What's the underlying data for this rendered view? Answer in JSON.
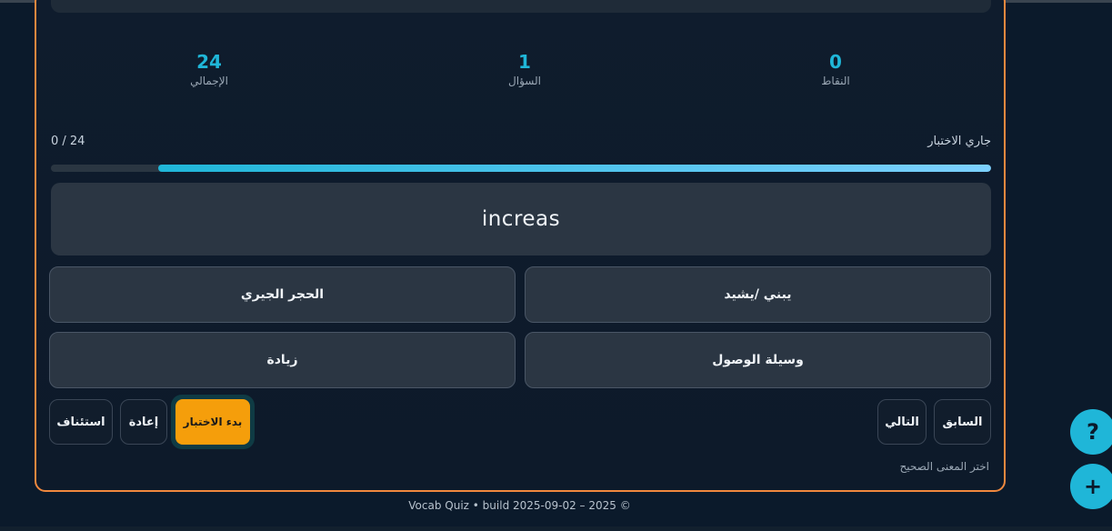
{
  "stats": {
    "total_value": "24",
    "total_label": "الإجمالي",
    "question_value": "1",
    "question_label": "السؤال",
    "points_value": "0",
    "points_label": "النقاط"
  },
  "status": {
    "count_text": "0 / 24",
    "state_text": "جاري الاختبار",
    "progress_fraction": 0.886
  },
  "question": {
    "word": "increas"
  },
  "options": [
    {
      "label": "يبني /يشيد"
    },
    {
      "label": "الحجر الجيري"
    },
    {
      "label": "وسيلة الوصول"
    },
    {
      "label": "زيادة"
    }
  ],
  "controls": {
    "previous_label": "السابق",
    "next_label": "التالي",
    "start_label": "بدء الاختبار",
    "reset_label": "إعادة",
    "resume_label": "استئناف"
  },
  "hint": "اختر المعنى الصحيح",
  "footer": "Vocab Quiz • build 2025-09-02 – 2025 ©",
  "fabs": {
    "help_glyph": "?",
    "add_glyph": "+",
    "help_icon": "question-icon",
    "add_icon": "plus-icon"
  },
  "colors": {
    "accent": "#1fb6d8",
    "border": "#f0883e",
    "start_button": "#f59e0b"
  }
}
